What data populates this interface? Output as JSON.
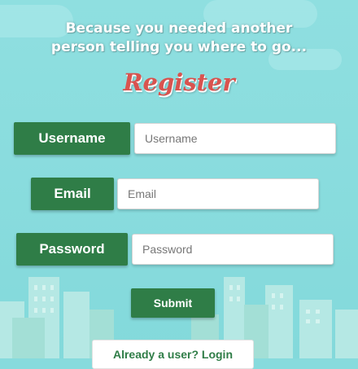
{
  "tagline": {
    "line1": "Because you needed another",
    "line2": "person telling you where to go..."
  },
  "title": "Register",
  "fields": {
    "username": {
      "label": "Username",
      "placeholder": "Username"
    },
    "email": {
      "label": "Email",
      "placeholder": "Email"
    },
    "password": {
      "label": "Password",
      "placeholder": "Password"
    }
  },
  "submit_label": "Submit",
  "login_label": "Already a user? Login",
  "colors": {
    "background": "#87dbdd",
    "accent": "#2f7d47",
    "title": "#d9534f"
  }
}
